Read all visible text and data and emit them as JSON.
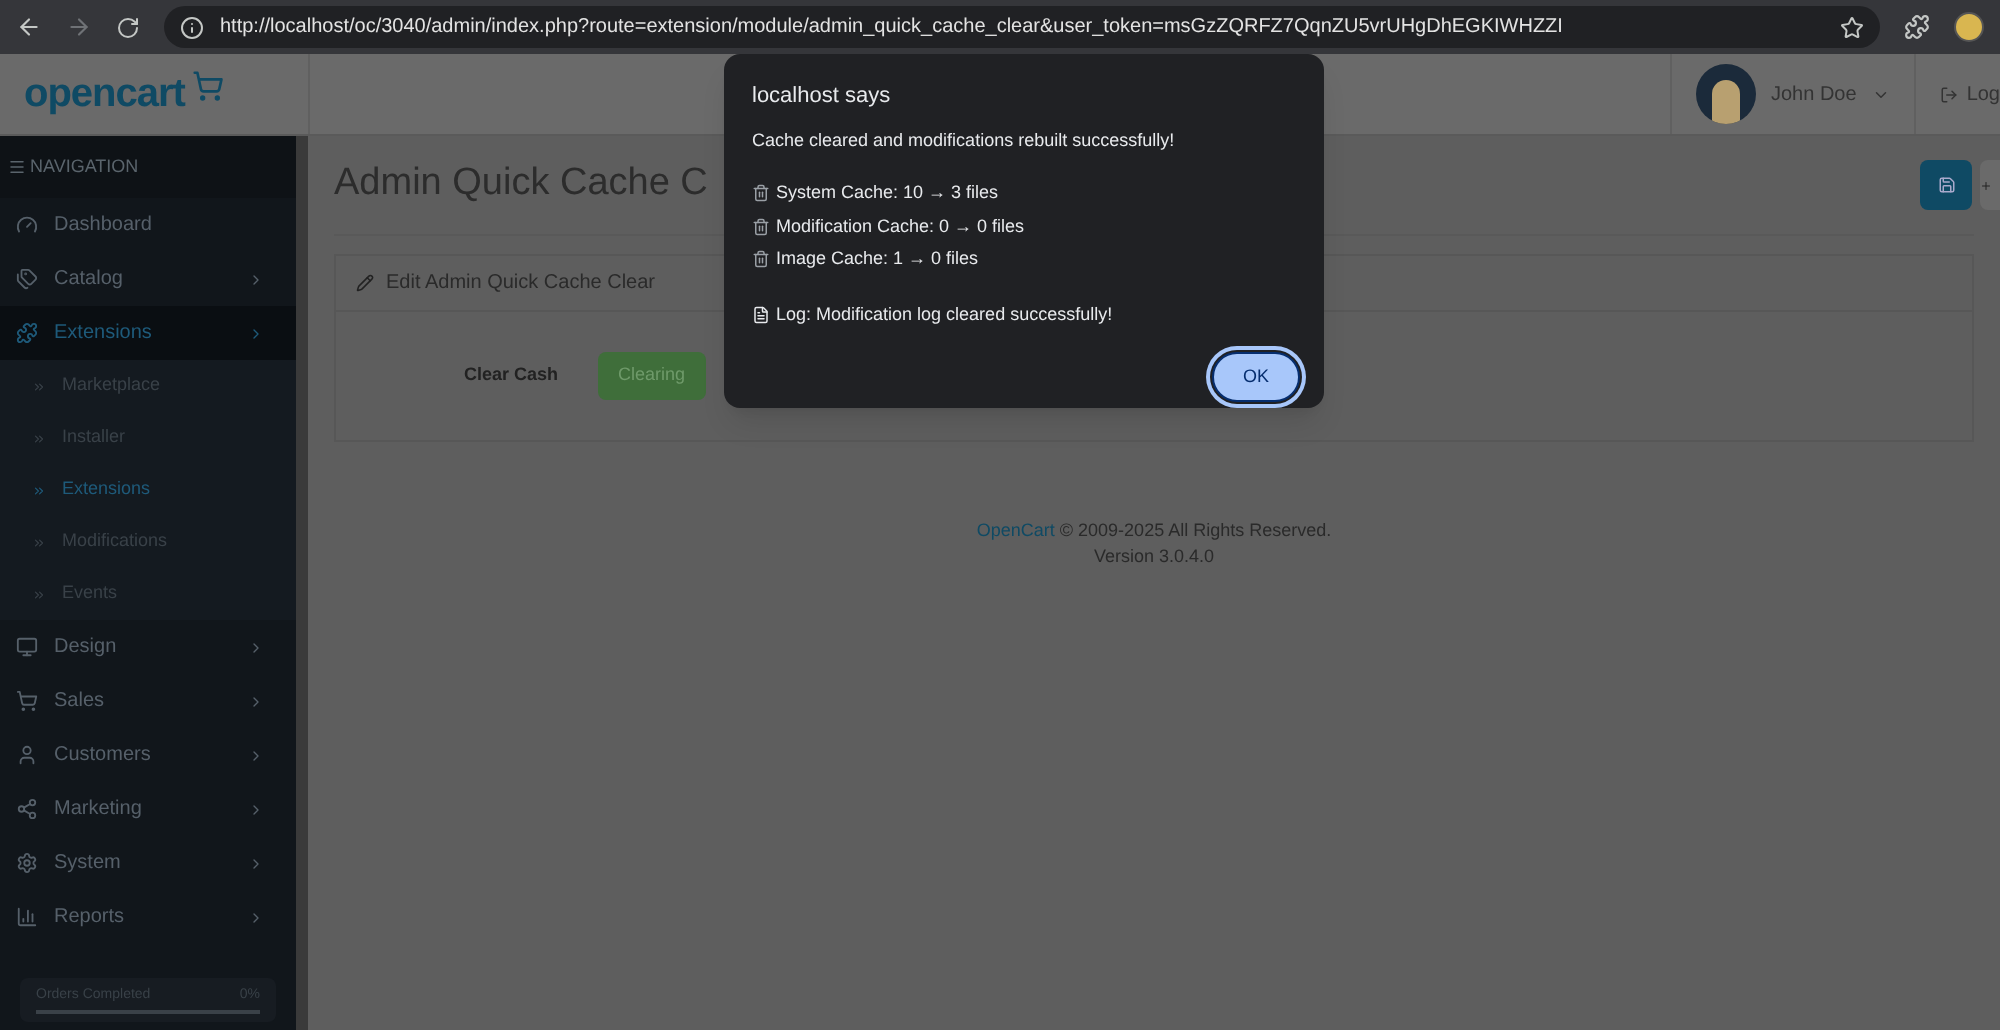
{
  "browser": {
    "url": "http://localhost/oc/3040/admin/index.php?route=extension/module/admin_quick_cache_clear&user_token=msGzZQRFZ7QqnZU5vrUHgDhEGKIWHZZI"
  },
  "header": {
    "logo": "opencart",
    "user": "John Doe",
    "logout": "Log"
  },
  "sidebar": {
    "heading": "NAVIGATION",
    "items": [
      {
        "label": "Dashboard",
        "selected": false
      },
      {
        "label": "Catalog",
        "selected": false
      },
      {
        "label": "Extensions",
        "selected": true,
        "children": [
          {
            "label": "Marketplace",
            "selected": false
          },
          {
            "label": "Installer",
            "selected": false
          },
          {
            "label": "Extensions",
            "selected": true
          },
          {
            "label": "Modifications",
            "selected": false
          },
          {
            "label": "Events",
            "selected": false
          }
        ]
      },
      {
        "label": "Design",
        "selected": false
      },
      {
        "label": "Sales",
        "selected": false
      },
      {
        "label": "Customers",
        "selected": false
      },
      {
        "label": "Marketing",
        "selected": false
      },
      {
        "label": "System",
        "selected": false
      },
      {
        "label": "Reports",
        "selected": false
      }
    ],
    "progress": {
      "label": "Orders Completed",
      "reading": "0%",
      "level": 0
    }
  },
  "page": {
    "title": "Admin Quick Cache C",
    "panel_title": "Edit Admin Quick Cache Clear",
    "field_label": "Clear Cash",
    "button": "Clearing"
  },
  "footer": {
    "link": "OpenCart",
    "text": "© 2009-2025 All Rights Reserved.",
    "version": "Version 3.0.4.0"
  },
  "dialog": {
    "title": "localhost says",
    "message": "Cache cleared and modifications rebuilt successfully!",
    "lines": [
      {
        "kind": "trash",
        "text": "System Cache: 10 → 3 files"
      },
      {
        "kind": "trash",
        "text": "Modification Cache: 0 → 0 files"
      },
      {
        "kind": "trash",
        "text": "Image Cache: 1 → 0 files"
      }
    ],
    "log": {
      "kind": "document",
      "text": "Log: Modification log cleared successfully!"
    },
    "ok": "OK"
  }
}
